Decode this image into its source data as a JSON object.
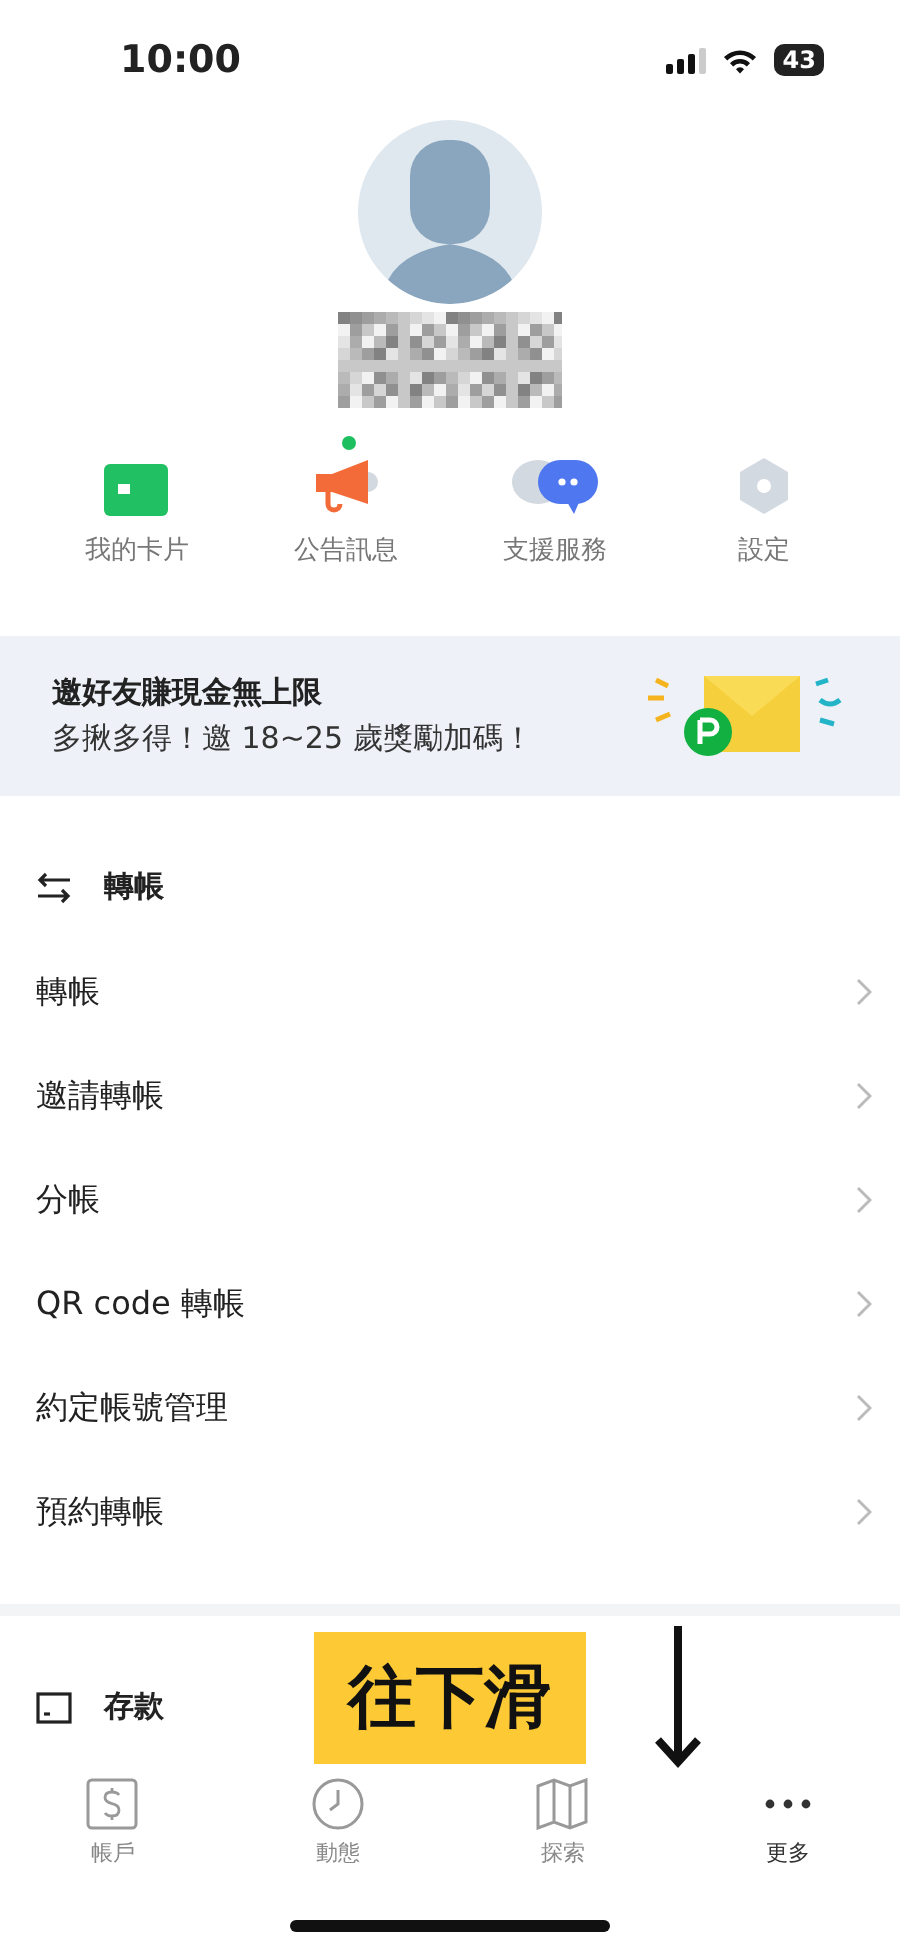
{
  "status_bar": {
    "time": "10:00",
    "battery": "43"
  },
  "profile": {
    "name_hidden": true
  },
  "quick_actions": [
    {
      "kind": "card",
      "label": "我的卡片"
    },
    {
      "kind": "megaphone",
      "label": "公告訊息",
      "dot": true
    },
    {
      "kind": "chat",
      "label": "支援服務"
    },
    {
      "kind": "gear",
      "label": "設定"
    }
  ],
  "banner": {
    "title": "邀好友賺現金無上限",
    "subtitle": "多揪多得！邀 18~25 歲獎勵加碼！"
  },
  "sections": [
    {
      "kind": "transfer",
      "title": "轉帳",
      "items": [
        "轉帳",
        "邀請轉帳",
        "分帳",
        "QR code 轉帳",
        "約定帳號管理",
        "預約轉帳"
      ]
    },
    {
      "kind": "deposit",
      "title": "存款"
    }
  ],
  "annotation": {
    "text": "往下滑"
  },
  "tab_bar": [
    {
      "kind": "dollar",
      "label": "帳戶",
      "selected": false
    },
    {
      "kind": "clock",
      "label": "動態",
      "selected": false
    },
    {
      "kind": "map",
      "label": "探索",
      "selected": false
    },
    {
      "kind": "more",
      "label": "更多",
      "selected": true
    }
  ]
}
